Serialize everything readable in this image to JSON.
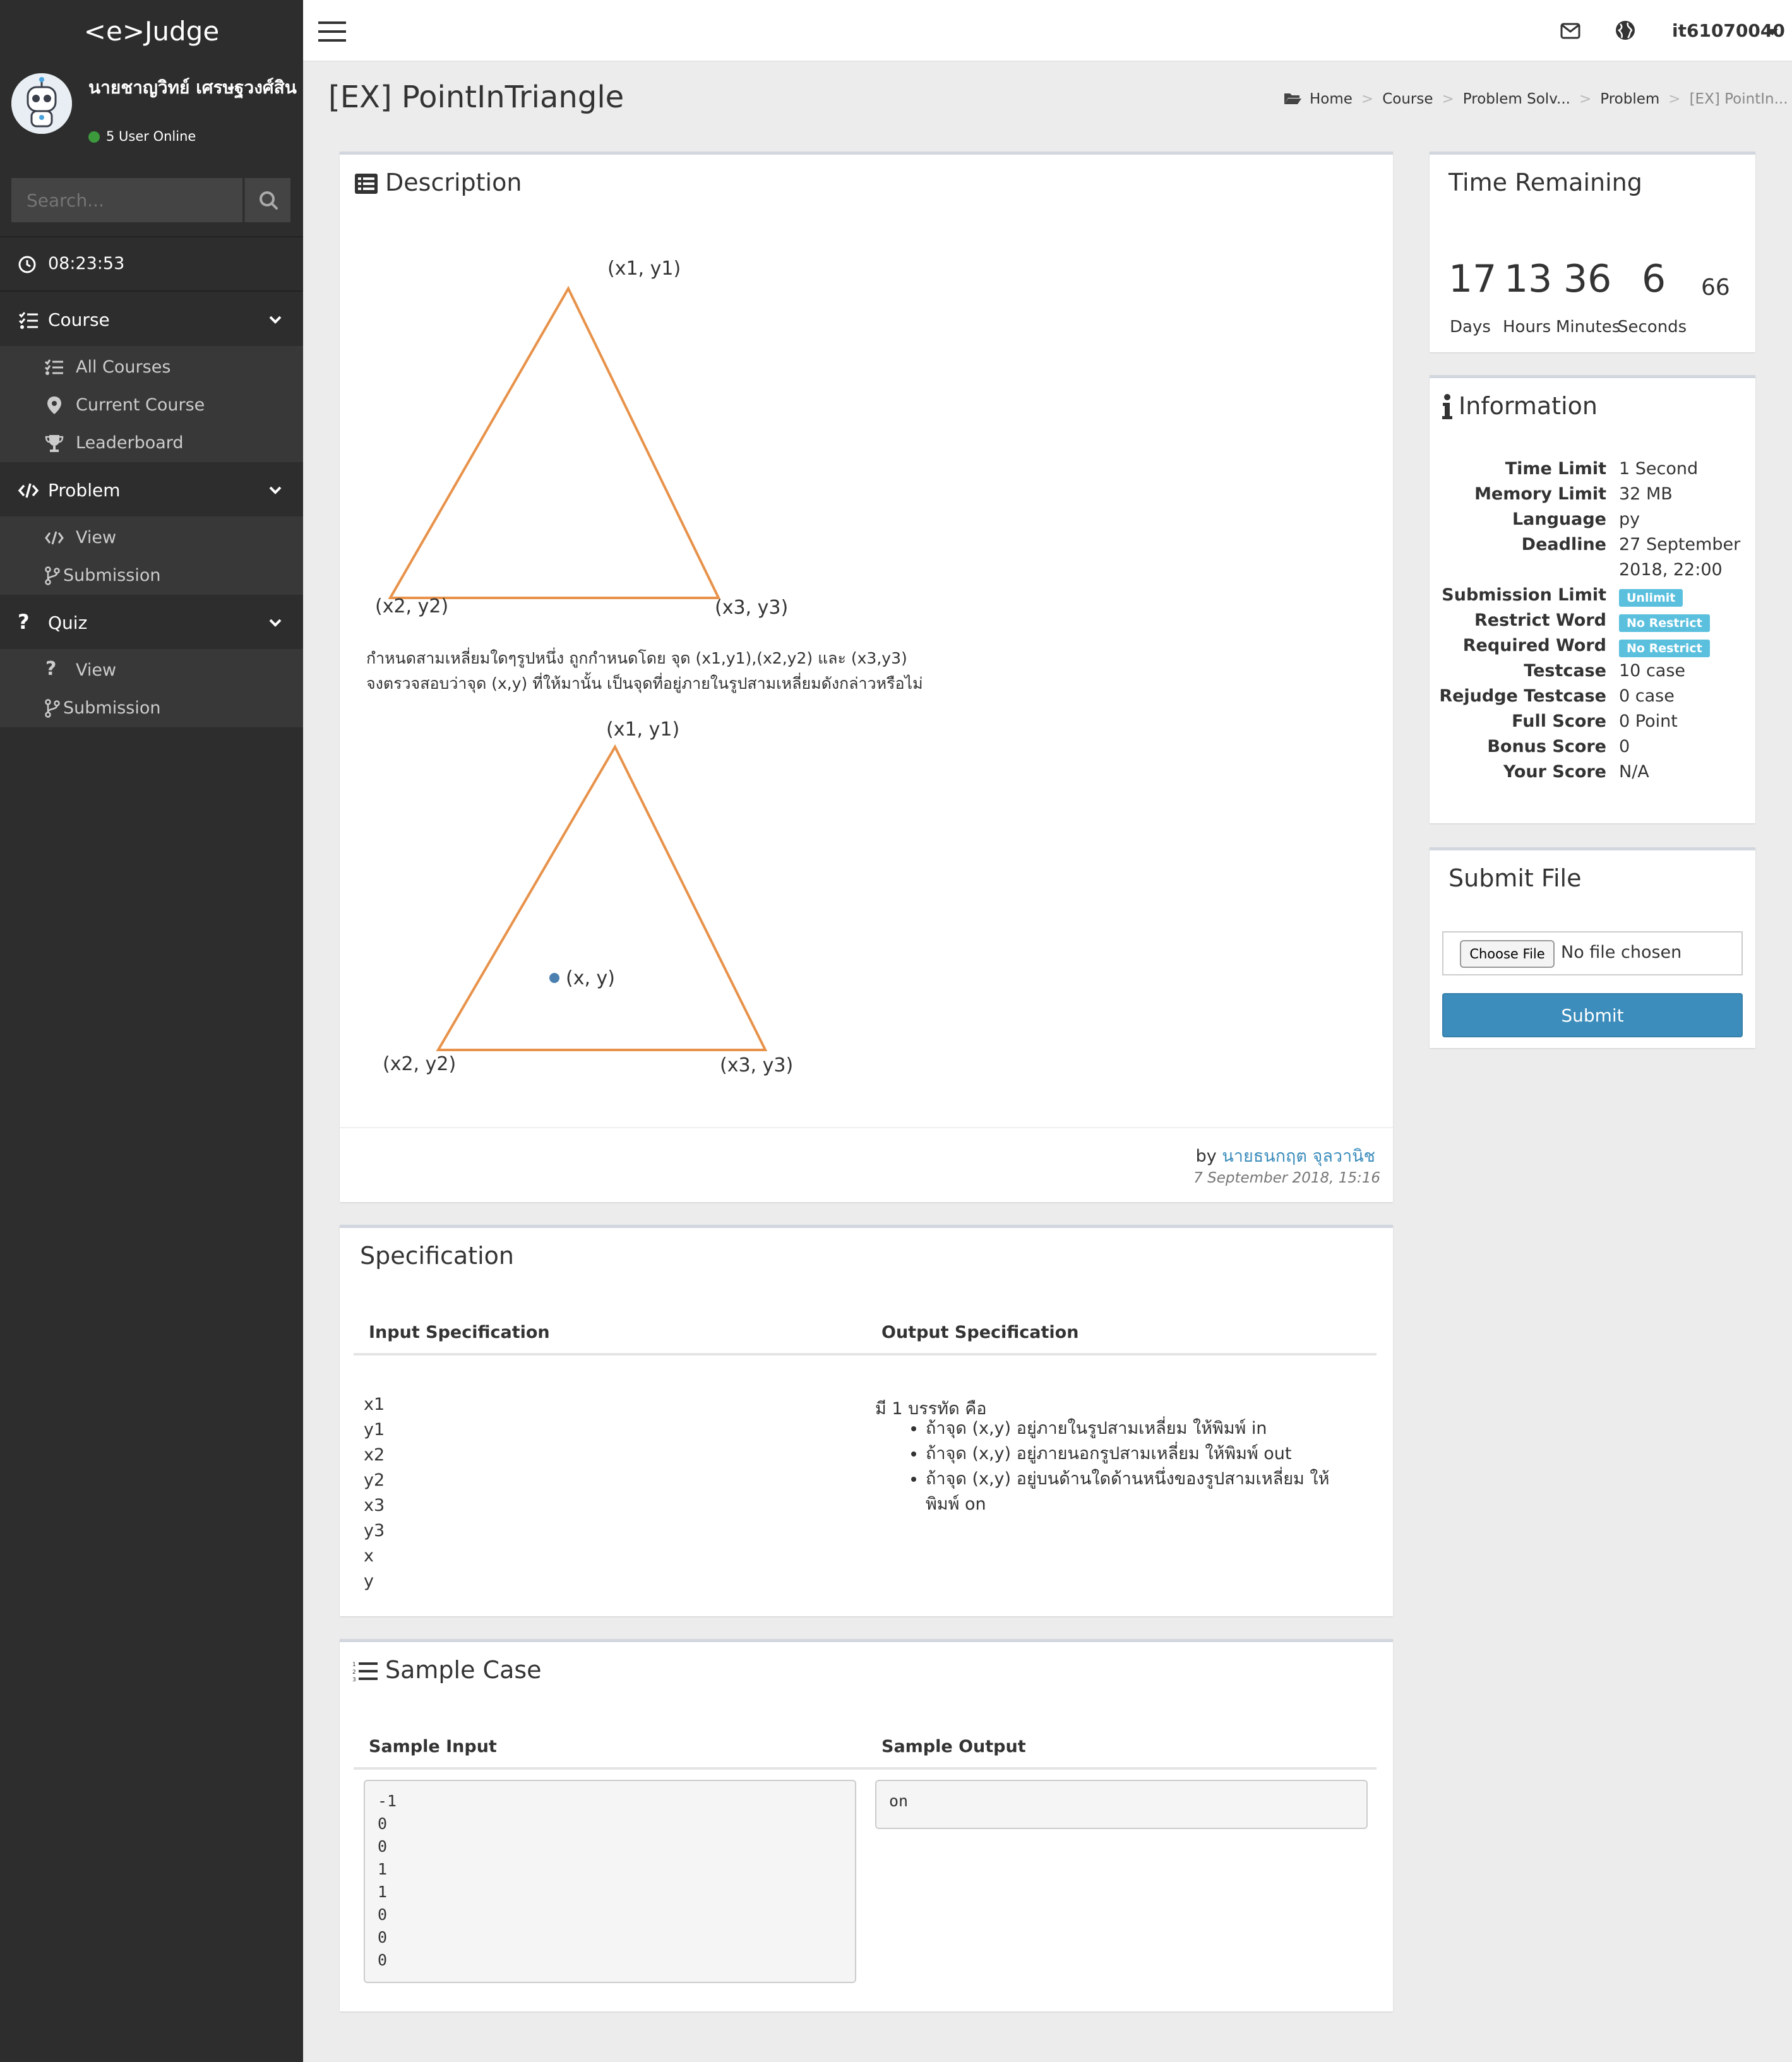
{
  "app": {
    "logo": "<e>Judge"
  },
  "user": {
    "name": "นายชาญวิทย์ เศรษฐวงศ์สิน",
    "online": "5 User Online",
    "top_username": "it61070040"
  },
  "search": {
    "placeholder": "Search..."
  },
  "clock": "08:23:53",
  "nav": {
    "course": {
      "label": "Course",
      "items": [
        "All Courses",
        "Current Course",
        "Leaderboard"
      ]
    },
    "problem": {
      "label": "Problem",
      "items": [
        "View",
        "Submission"
      ]
    },
    "quiz": {
      "label": "Quiz",
      "items": [
        "View",
        "Submission"
      ]
    }
  },
  "page": {
    "title": "[EX] PointInTriangle"
  },
  "breadcrumb": [
    "Home",
    "Course",
    "Problem Solv...",
    "Problem",
    "[EX] PointIn..."
  ],
  "description": {
    "title": "Description",
    "figure1": {
      "top": "(x1, y1)",
      "left": "(x2, y2)",
      "right": "(x3, y3)"
    },
    "text_line1": "กำหนดสามเหลี่ยมใดๆรูปหนึ่ง ถูกกำหนดโดย จุด (x1,y1),(x2,y2) และ (x3,y3)",
    "text_line2": "จงตรวจสอบว่าจุด (x,y) ที่ให้มานั้น เป็นจุดที่อยู่ภายในรูปสามเหลี่ยมดังกล่าวหรือไม่",
    "figure2": {
      "top": "(x1, y1)",
      "left": "(x2, y2)",
      "right": "(x3, y3)",
      "point": "(x, y)"
    },
    "by": "by",
    "author": "นายธนกฤต จุลวานิช",
    "date": "7 September 2018, 15:16"
  },
  "time_remaining": {
    "title": "Time Remaining",
    "days": "17",
    "hours": "13",
    "minutes": "36",
    "seconds": "6",
    "extra": "66",
    "labels": {
      "days": "Days",
      "hours": "Hours",
      "minutes": "Minutes",
      "seconds": "Seconds"
    }
  },
  "information": {
    "title": "Information",
    "rows": [
      {
        "key": "Time Limit",
        "value": "1 Second"
      },
      {
        "key": "Memory Limit",
        "value": "32 MB"
      },
      {
        "key": "Language",
        "value": "py"
      },
      {
        "key": "Deadline",
        "value": "27 September",
        "value2": "2018, 22:00"
      },
      {
        "key": "Submission Limit",
        "badge": "Unlimit"
      },
      {
        "key": "Restrict Word",
        "badge": "No Restrict"
      },
      {
        "key": "Required Word",
        "badge": "No Restrict"
      },
      {
        "key": "Testcase",
        "value": "10 case"
      },
      {
        "key": "Rejudge Testcase",
        "value": "0 case"
      },
      {
        "key": "Full Score",
        "value": "0 Point"
      },
      {
        "key": "Bonus Score",
        "value": "0"
      },
      {
        "key": "Your Score",
        "value": "N/A"
      }
    ]
  },
  "submit_file": {
    "title": "Submit File",
    "choose": "Choose File",
    "no_file": "No file chosen",
    "submit": "Submit"
  },
  "specification": {
    "title": "Specification",
    "input_header": "Input Specification",
    "output_header": "Output Specification",
    "input_lines": [
      "x1",
      "y1",
      "x2",
      "y2",
      "x3",
      "y3",
      "x",
      "y"
    ],
    "output_intro": "มี 1 บรรทัด คือ",
    "output_items": [
      "ถ้าจุด (x,y) อยู่ภายในรูปสามเหลี่ยม ให้พิมพ์ in",
      "ถ้าจุด (x,y) อยู่ภายนอกรูปสามเหลี่ยม ให้พิมพ์ out",
      "ถ้าจุด (x,y) อยู่บนด้านใดด้านหนึ่งของรูปสามเหลี่ยม ให้พิมพ์ on"
    ]
  },
  "sample": {
    "title": "Sample Case",
    "input_header": "Sample Input",
    "output_header": "Sample Output",
    "input": "-1\n0\n0\n1\n1\n0\n0\n0",
    "output": "on"
  },
  "colors": {
    "sidebar": "#2d2d2d",
    "accent": "#3c8dbc",
    "badge": "#5bc0de",
    "triangle": "#e8924a",
    "point": "#4a7fb0"
  }
}
